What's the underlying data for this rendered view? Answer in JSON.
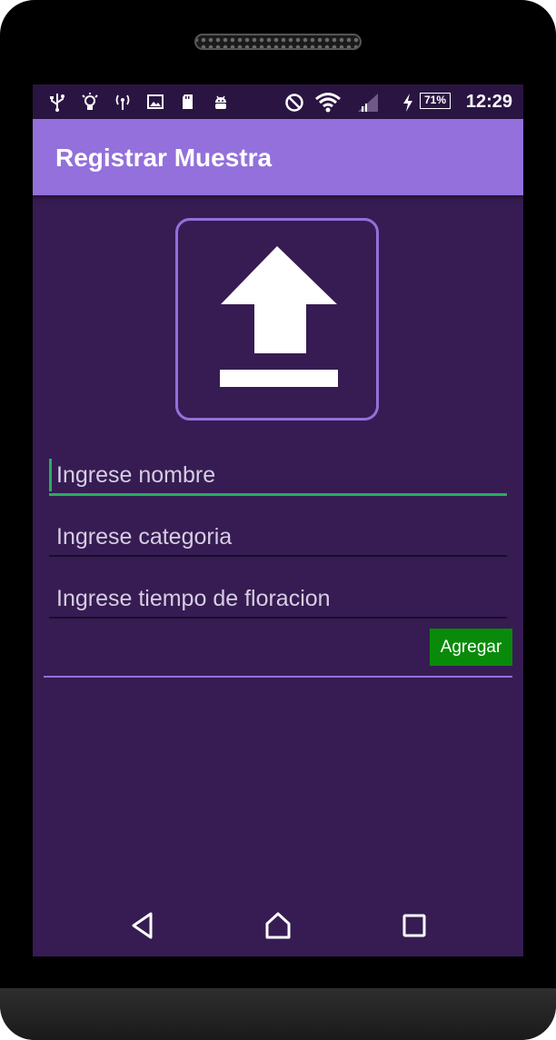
{
  "status_bar": {
    "icons": [
      "usb-icon",
      "bulb-icon",
      "radio-tower-icon",
      "image-icon",
      "sd-card-icon",
      "android-icon",
      "do-not-disturb-icon",
      "wifi-icon",
      "signal-icon",
      "charging-icon"
    ],
    "battery": "71%",
    "time": "12:29"
  },
  "app_bar": {
    "title": "Registrar Muestra",
    "color": "#9370db"
  },
  "upload": {
    "icon": "upload-icon"
  },
  "form": {
    "nombre_placeholder": "Ingrese nombre",
    "categoria_placeholder": "Ingrese categoria",
    "floracion_placeholder": "Ingrese tiempo de floracion",
    "add_label": "Agregar"
  },
  "nav_bar": {
    "icons": [
      "back-icon",
      "home-icon",
      "recents-icon"
    ]
  },
  "colors": {
    "background": "#361c52",
    "accent": "#9370db",
    "focus": "#27ae60",
    "button": "#0a8a0a"
  }
}
